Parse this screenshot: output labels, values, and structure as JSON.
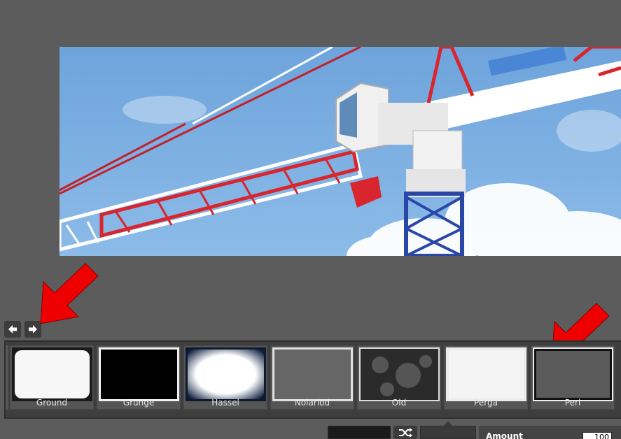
{
  "navigation": {
    "prev_icon": "arrow-left-icon",
    "next_icon": "arrow-right-icon"
  },
  "frames": [
    {
      "label": "Ground",
      "style": "white-rounded"
    },
    {
      "label": "Grunge",
      "style": "black-rough"
    },
    {
      "label": "Hassel",
      "style": "white-vignette"
    },
    {
      "label": "Nolariod",
      "style": "gray-plain"
    },
    {
      "label": "Old",
      "style": "dark-texture"
    },
    {
      "label": "Perga",
      "style": "light-paper"
    },
    {
      "label": "Peri",
      "style": "gray-dark-border"
    }
  ],
  "controls": {
    "shuffle_icon": "shuffle-icon",
    "amount_label": "Amount",
    "amount_value": "100"
  },
  "colors": {
    "background": "#5c5c5c",
    "sky": "#79ace0",
    "crane_red": "#d8252e",
    "annotation_red": "#ee0000"
  },
  "annotations": [
    "red-arrow-pointing-to-next-button",
    "red-arrow-pointing-to-peri-frame"
  ]
}
